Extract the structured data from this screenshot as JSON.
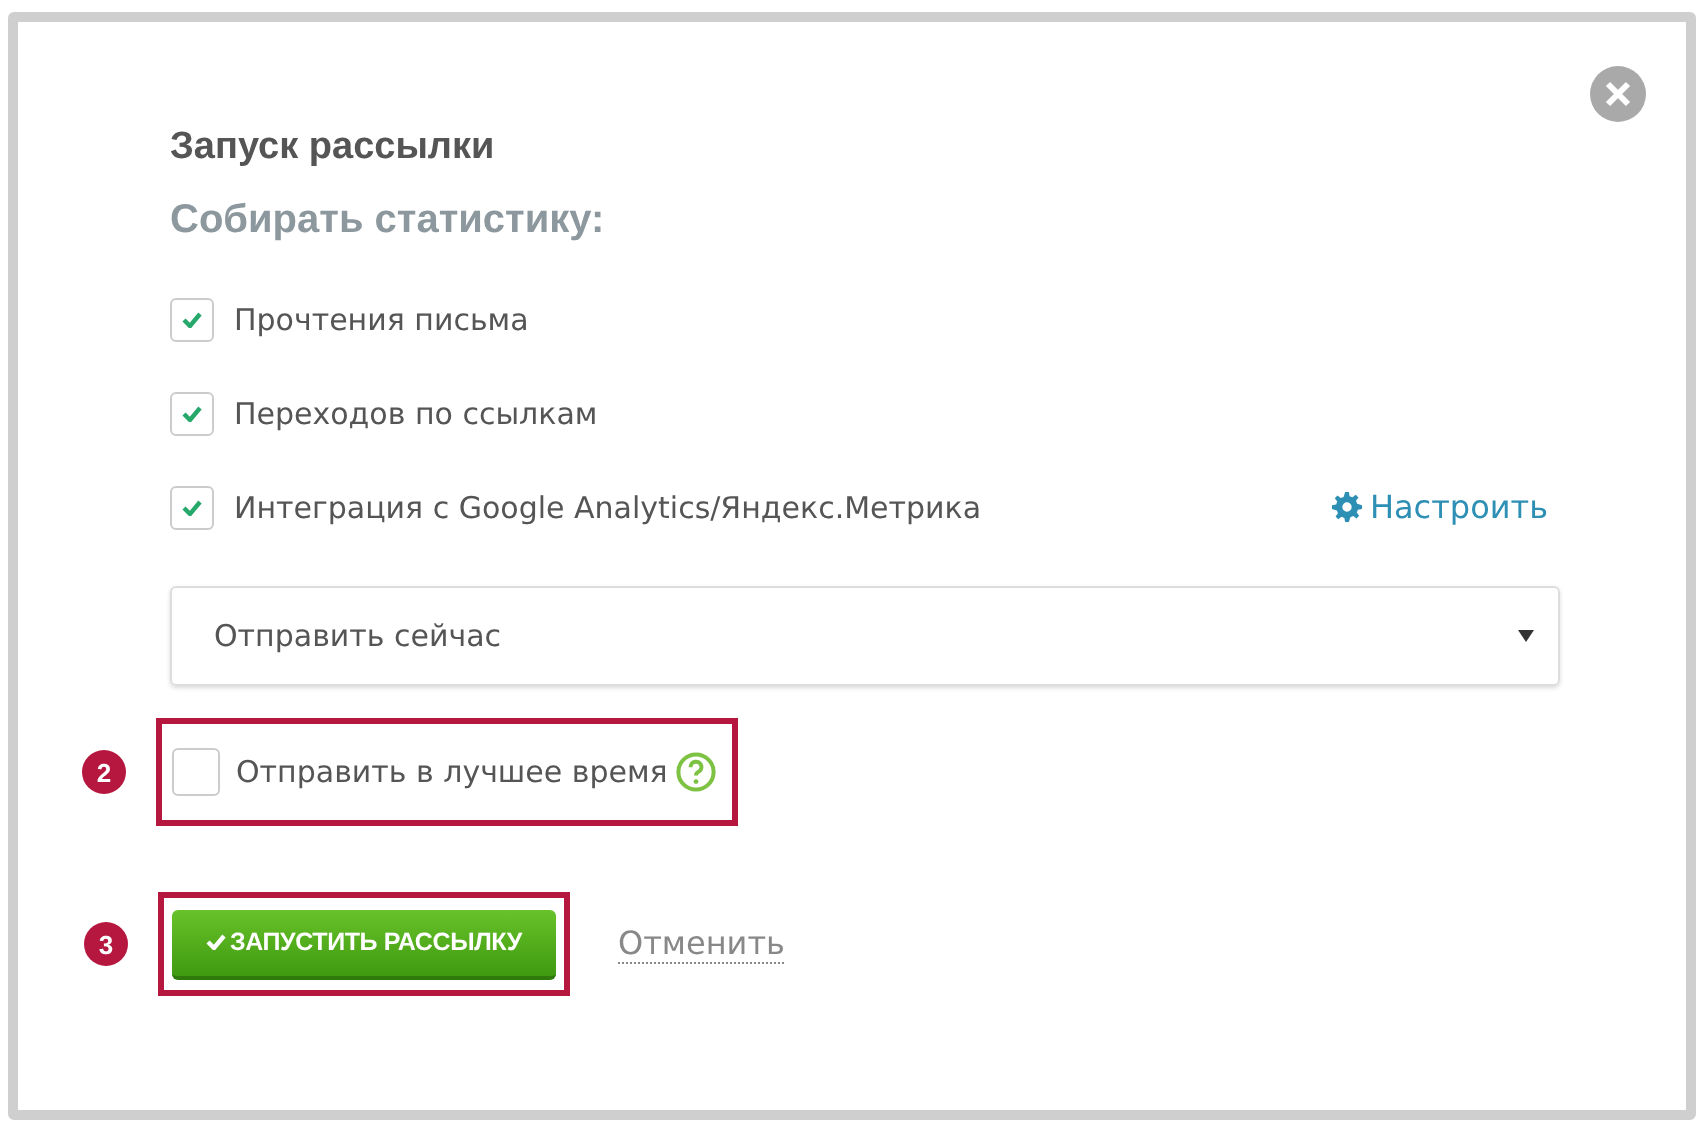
{
  "dialog": {
    "title": "Запуск рассылки",
    "section_title": "Собирать статистику:",
    "stats": [
      {
        "label": "Прочтения письма",
        "checked": true
      },
      {
        "label": "Переходов по ссылкам",
        "checked": true
      },
      {
        "label": "Интеграция с Google Analytics/Яндекс.Метрика",
        "checked": true
      }
    ],
    "configure_link": "Настроить",
    "send_mode": {
      "value": "Отправить сейчас"
    },
    "best_time": {
      "label": "Отправить в лучшее время",
      "checked": false,
      "callout": "2"
    },
    "launch_button": {
      "label": "ЗАПУСТИТЬ РАССЫЛКУ",
      "callout": "3"
    },
    "cancel_link": "Отменить"
  }
}
